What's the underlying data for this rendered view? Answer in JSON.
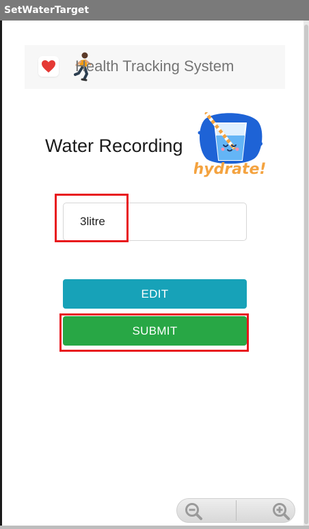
{
  "window": {
    "title": "SetWaterTarget"
  },
  "header": {
    "title": "Health Tracking System",
    "heart_icon": "heart-icon",
    "runner_icon": "runner-icon"
  },
  "main": {
    "page_title": "Water Recording",
    "illustration": {
      "caption": "hydrate!",
      "icon": "water-glass-icon"
    },
    "water_input": {
      "value": "3litre"
    },
    "edit_label": "EDIT",
    "submit_label": "SUBMIT"
  },
  "colors": {
    "edit_button": "#17a2b8",
    "submit_button": "#28a745",
    "highlight": "#e8141b",
    "heart": "#e53935"
  },
  "zoom": {
    "out_icon": "zoom-out-icon",
    "in_icon": "zoom-in-icon"
  }
}
